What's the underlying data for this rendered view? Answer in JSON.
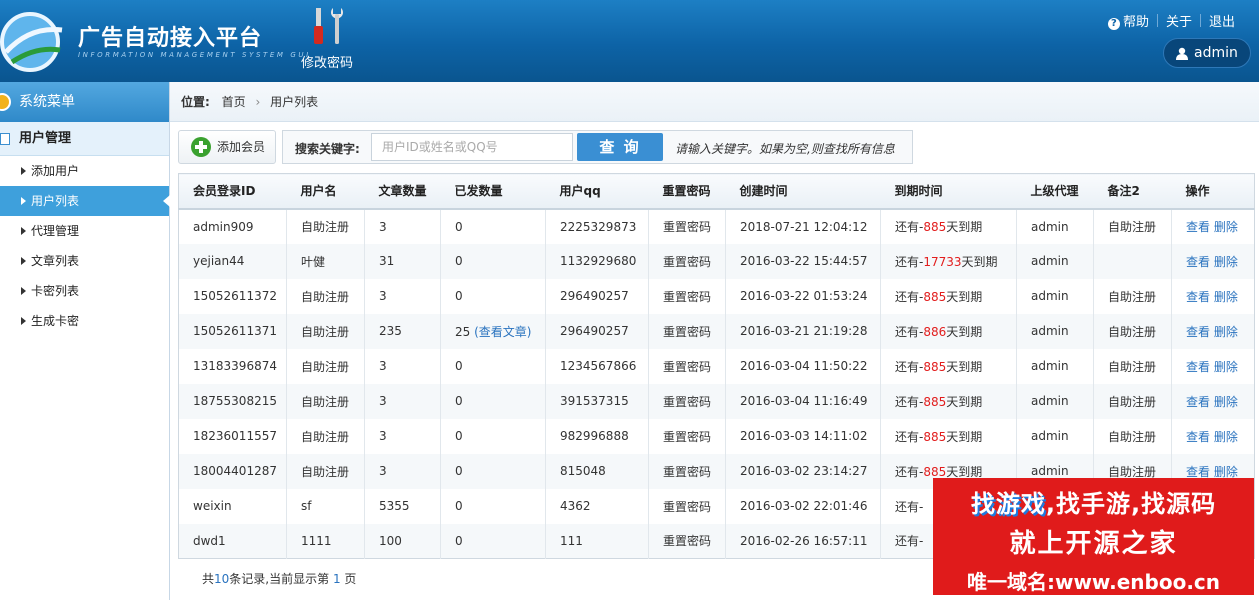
{
  "header": {
    "title": "广告自动接入平台",
    "subtitle": "INFORMATION MANAGEMENT SYSTEM GUI",
    "tool_label": "修改密码",
    "links": {
      "help": "帮助",
      "about": "关于",
      "logout": "退出"
    },
    "user": "admin",
    "colors": {
      "bar": "#0d63a6"
    }
  },
  "sidebar": {
    "title": "系统菜单",
    "group": "用户管理",
    "items": [
      {
        "label": "添加用户",
        "active": false
      },
      {
        "label": "用户列表",
        "active": true
      },
      {
        "label": "代理管理",
        "active": false
      },
      {
        "label": "文章列表",
        "active": false
      },
      {
        "label": "卡密列表",
        "active": false
      },
      {
        "label": "生成卡密",
        "active": false
      }
    ]
  },
  "breadcrumb": {
    "label": "位置:",
    "home": "首页",
    "current": "用户列表"
  },
  "toolbar": {
    "add_label": "添加会员",
    "search_label": "搜索关键字:",
    "search_placeholder": "用户ID或姓名或QQ号",
    "search_button": "查 询",
    "hint": "请输入关键字。如果为空,则查找所有信息"
  },
  "table": {
    "columns": [
      "会员登录ID",
      "用户名",
      "文章数量",
      "已发数量",
      "用户qq",
      "重置密码",
      "创建时间",
      "到期时间",
      "上级代理",
      "备注2",
      "操作"
    ],
    "rows": [
      {
        "id": "admin909",
        "name": "自助注册",
        "articles": "3",
        "sent": "0",
        "sent_link": "",
        "qq": "2225329873",
        "reset": "重置密码",
        "created": "2018-07-21 12:04:12",
        "exp_pre": "还有-",
        "exp_days": "885",
        "exp_post": "天到期",
        "agent": "admin",
        "note": "自助注册",
        "view": "查看",
        "del": "删除"
      },
      {
        "id": "yejian44",
        "name": "叶健",
        "articles": "31",
        "sent": "0",
        "sent_link": "",
        "qq": "1132929680",
        "reset": "重置密码",
        "created": "2016-03-22 15:44:57",
        "exp_pre": "还有-",
        "exp_days": "17733",
        "exp_post": "天到期",
        "agent": "admin",
        "note": "",
        "view": "查看",
        "del": "删除"
      },
      {
        "id": "15052611372",
        "name": "自助注册",
        "articles": "3",
        "sent": "0",
        "sent_link": "",
        "qq": "296490257",
        "reset": "重置密码",
        "created": "2016-03-22 01:53:24",
        "exp_pre": "还有-",
        "exp_days": "885",
        "exp_post": "天到期",
        "agent": "admin",
        "note": "自助注册",
        "view": "查看",
        "del": "删除"
      },
      {
        "id": "15052611371",
        "name": "自助注册",
        "articles": "235",
        "sent": "25",
        "sent_link": "(查看文章)",
        "qq": "296490257",
        "reset": "重置密码",
        "created": "2016-03-21 21:19:28",
        "exp_pre": "还有-",
        "exp_days": "886",
        "exp_post": "天到期",
        "agent": "admin",
        "note": "自助注册",
        "view": "查看",
        "del": "删除"
      },
      {
        "id": "13183396874",
        "name": "自助注册",
        "articles": "3",
        "sent": "0",
        "sent_link": "",
        "qq": "1234567866",
        "reset": "重置密码",
        "created": "2016-03-04 11:50:22",
        "exp_pre": "还有-",
        "exp_days": "885",
        "exp_post": "天到期",
        "agent": "admin",
        "note": "自助注册",
        "view": "查看",
        "del": "删除"
      },
      {
        "id": "18755308215",
        "name": "自助注册",
        "articles": "3",
        "sent": "0",
        "sent_link": "",
        "qq": "391537315",
        "reset": "重置密码",
        "created": "2016-03-04 11:16:49",
        "exp_pre": "还有-",
        "exp_days": "885",
        "exp_post": "天到期",
        "agent": "admin",
        "note": "自助注册",
        "view": "查看",
        "del": "删除"
      },
      {
        "id": "18236011557",
        "name": "自助注册",
        "articles": "3",
        "sent": "0",
        "sent_link": "",
        "qq": "982996888",
        "reset": "重置密码",
        "created": "2016-03-03 14:11:02",
        "exp_pre": "还有-",
        "exp_days": "885",
        "exp_post": "天到期",
        "agent": "admin",
        "note": "自助注册",
        "view": "查看",
        "del": "删除"
      },
      {
        "id": "18004401287",
        "name": "自助注册",
        "articles": "3",
        "sent": "0",
        "sent_link": "",
        "qq": "815048",
        "reset": "重置密码",
        "created": "2016-03-02 23:14:27",
        "exp_pre": "还有-",
        "exp_days": "885",
        "exp_post": "天到期",
        "agent": "admin",
        "note": "自助注册",
        "view": "查看",
        "del": "删除"
      },
      {
        "id": "weixin",
        "name": "sf",
        "articles": "5355",
        "sent": "0",
        "sent_link": "",
        "qq": "4362",
        "reset": "重置密码",
        "created": "2016-03-02 22:01:46",
        "exp_pre": "还有-",
        "exp_days": "",
        "exp_post": "",
        "agent": "",
        "note": "",
        "view": "",
        "del": ""
      },
      {
        "id": "dwd1",
        "name": "1111",
        "articles": "100",
        "sent": "0",
        "sent_link": "",
        "qq": "111",
        "reset": "重置密码",
        "created": "2016-02-26 16:57:11",
        "exp_pre": "还有-",
        "exp_days": "",
        "exp_post": "",
        "agent": "",
        "note": "",
        "view": "",
        "del": ""
      }
    ]
  },
  "pager": {
    "prefix": "共",
    "total": "10",
    "mid": "条记录,当前显示第",
    "page": "1",
    "suffix": "页"
  },
  "ad": {
    "line1_a": "找游戏",
    "line1_b": ",找手游,找源码",
    "line2": "就上开源之家",
    "line3": "唯一域名:www.enboo.cn"
  }
}
